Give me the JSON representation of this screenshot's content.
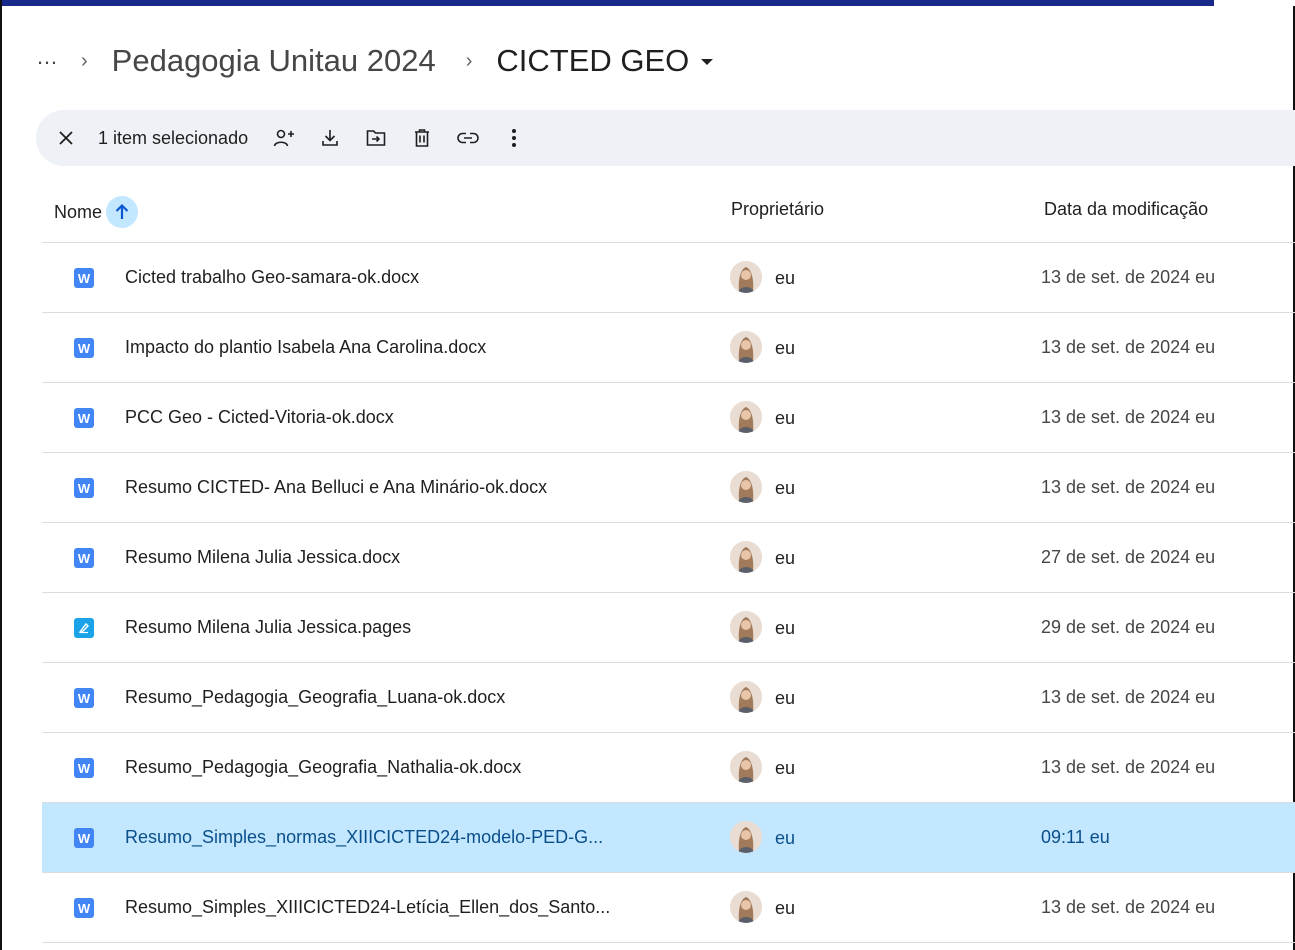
{
  "breadcrumb": {
    "more": "…",
    "separator": "›",
    "parent": "Pedagogia Unitau 2024",
    "current": "CICTED GEO"
  },
  "toolbar": {
    "selection_count": "1 item selecionado",
    "icons": [
      "close-icon",
      "share-person-add-icon",
      "download-icon",
      "move-to-folder-icon",
      "trash-icon",
      "link-icon",
      "more-vert-icon"
    ]
  },
  "columns": {
    "name": "Nome",
    "owner": "Proprietário",
    "modified": "Data da modificação"
  },
  "files": [
    {
      "name": "Cicted trabalho Geo-samara-ok.docx",
      "type_icon": "W",
      "owner": "eu",
      "modified": "13 de set. de 2024 eu",
      "selected": false
    },
    {
      "name": "Impacto do plantio Isabela Ana Carolina.docx",
      "type_icon": "W",
      "owner": "eu",
      "modified": "13 de set. de 2024 eu",
      "selected": false
    },
    {
      "name": "PCC Geo - Cicted-Vitoria-ok.docx",
      "type_icon": "W",
      "owner": "eu",
      "modified": "13 de set. de 2024 eu",
      "selected": false
    },
    {
      "name": "Resumo CICTED- Ana Belluci e Ana Minário-ok.docx",
      "type_icon": "W",
      "owner": "eu",
      "modified": "13 de set. de 2024 eu",
      "selected": false
    },
    {
      "name": "Resumo Milena Julia Jessica.docx",
      "type_icon": "W",
      "owner": "eu",
      "modified": "27 de set. de 2024 eu",
      "selected": false
    },
    {
      "name": "Resumo Milena Julia Jessica.pages",
      "type_icon": "pages",
      "owner": "eu",
      "modified": "29 de set. de 2024 eu",
      "selected": false
    },
    {
      "name": "Resumo_Pedagogia_Geografia_Luana-ok.docx",
      "type_icon": "W",
      "owner": "eu",
      "modified": "13 de set. de 2024 eu",
      "selected": false
    },
    {
      "name": "Resumo_Pedagogia_Geografia_Nathalia-ok.docx",
      "type_icon": "W",
      "owner": "eu",
      "modified": "13 de set. de 2024 eu",
      "selected": false
    },
    {
      "name": "Resumo_Simples_normas_XIIICICTED24-modelo-PED-G...",
      "type_icon": "W",
      "owner": "eu",
      "modified": "09:11 eu",
      "selected": true
    },
    {
      "name": "Resumo_Simples_XIIICICTED24-Letícia_Ellen_dos_Santo...",
      "type_icon": "W",
      "owner": "eu",
      "modified": "13 de set. de 2024 eu",
      "selected": false
    }
  ],
  "colors": {
    "selected_row": "#c2e7ff",
    "toolbar_bg": "#eef1f6",
    "doc_icon": "#4285f4",
    "pages_icon": "#1aa3e8",
    "top_bar": "#1a2a8c"
  }
}
